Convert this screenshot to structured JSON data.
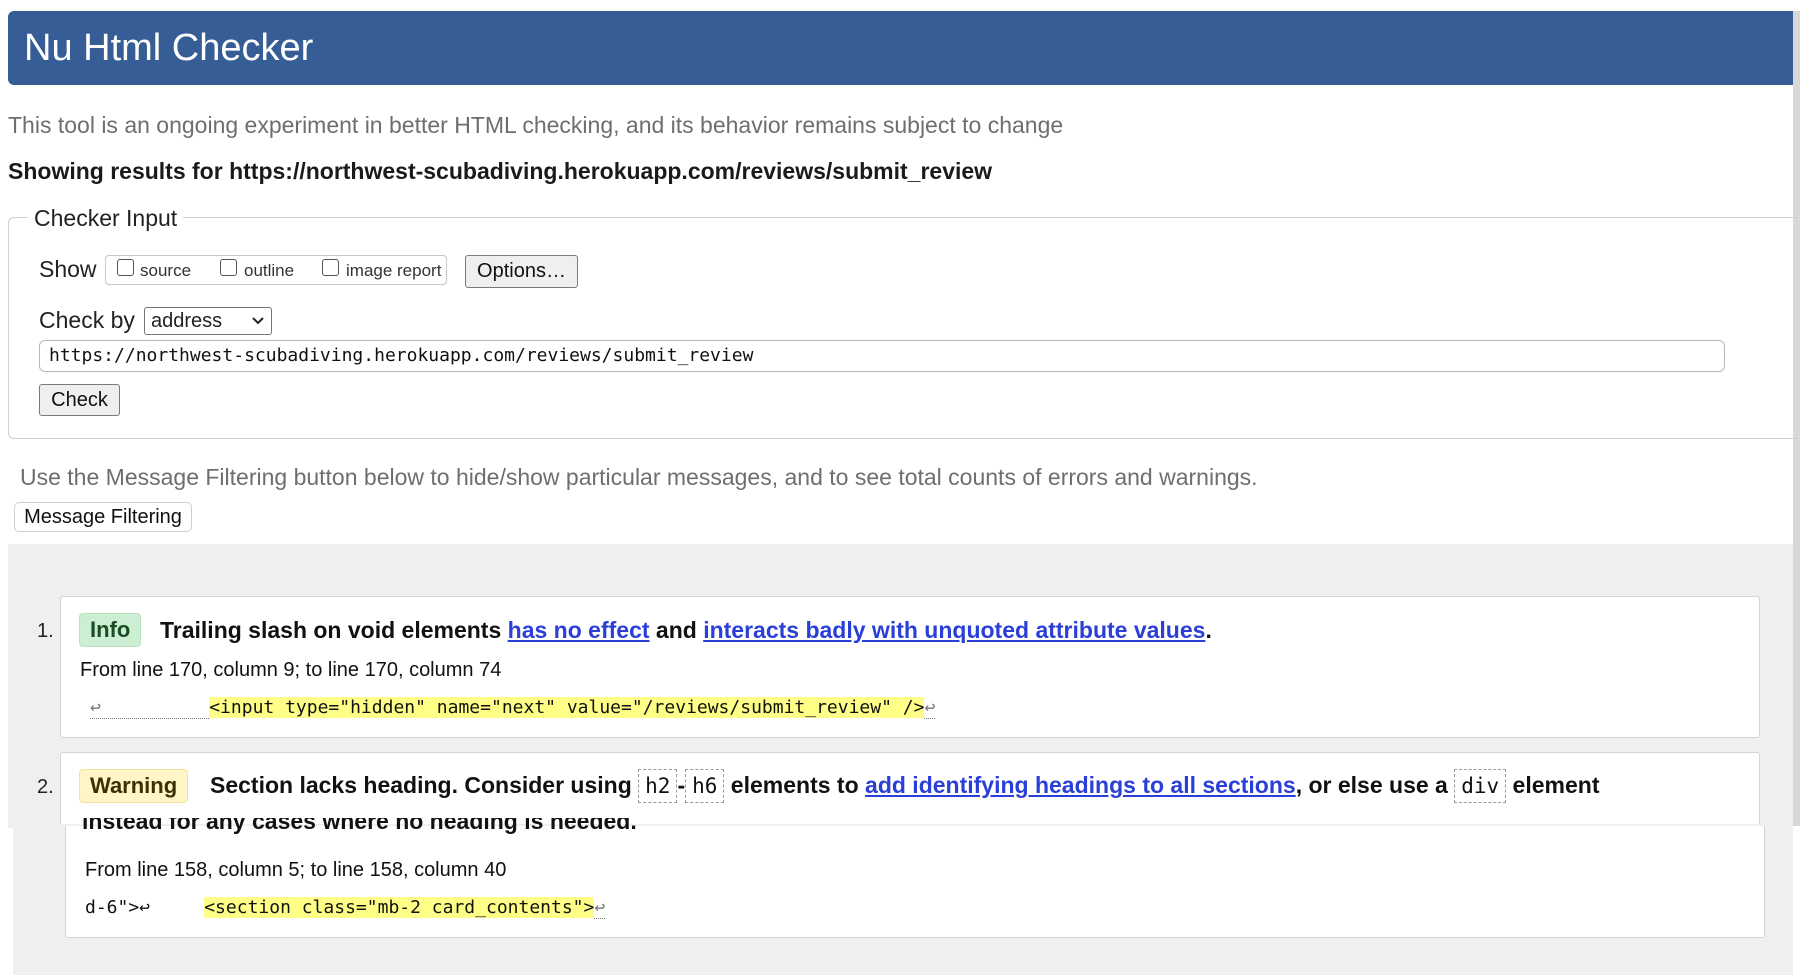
{
  "header": {
    "title": "Nu Html Checker"
  },
  "intro": {
    "subtitle": "This tool is an ongoing experiment in better HTML checking, and its behavior remains subject to change",
    "showing": "Showing results for https://northwest-scubadiving.herokuapp.com/reviews/submit_review"
  },
  "checker_input": {
    "legend": "Checker Input",
    "show_label": "Show",
    "options": [
      {
        "label": "source",
        "checked": false
      },
      {
        "label": "outline",
        "checked": false
      },
      {
        "label": "image report",
        "checked": false
      }
    ],
    "options_button": "Options…",
    "check_by_label": "Check by",
    "check_by_value": "address",
    "url": "https://northwest-scubadiving.herokuapp.com/reviews/submit_review",
    "check_button": "Check"
  },
  "filtering": {
    "info": "Use the Message Filtering button below to hide/show particular messages, and to see total counts of errors and warnings.",
    "button": "Message Filtering"
  },
  "messages": [
    {
      "number": "1.",
      "type": "Info",
      "text_parts": {
        "t1": "Trailing slash on void elements ",
        "link1": "has no effect",
        "t2": " and ",
        "link2": "interacts badly with unquoted attribute values",
        "t3": "."
      },
      "location": "From line 170, column 9; to line 170, column 74",
      "extract": {
        "before": "↩          ",
        "highlight": "<input type=\"hidden\" name=\"next\" value=\"/reviews/submit_review\" />",
        "after": "↩"
      }
    },
    {
      "number": "2.",
      "type": "Warning",
      "text_parts": {
        "t1": "Section lacks heading. Consider using ",
        "code1": "h2",
        "t2": "-",
        "code2": "h6",
        "t3": " elements to ",
        "link1": "add identifying headings to all sections",
        "t4": ", or else use a ",
        "code3": "div",
        "t5": " element",
        "line2": "instead for any cases where no heading is needed."
      },
      "location": "From line 158, column 5; to line 158, column 40",
      "extract": {
        "before": "d-6\">↩     ",
        "highlight": "<section class=\"mb-2 card_contents\">",
        "after": "↩"
      }
    }
  ],
  "colors": {
    "header_bg": "#365d95",
    "info_badge": "#ccefd3",
    "warning_badge": "#fff5c6",
    "link": "#2a3fd8",
    "highlight": "#ffff88"
  }
}
